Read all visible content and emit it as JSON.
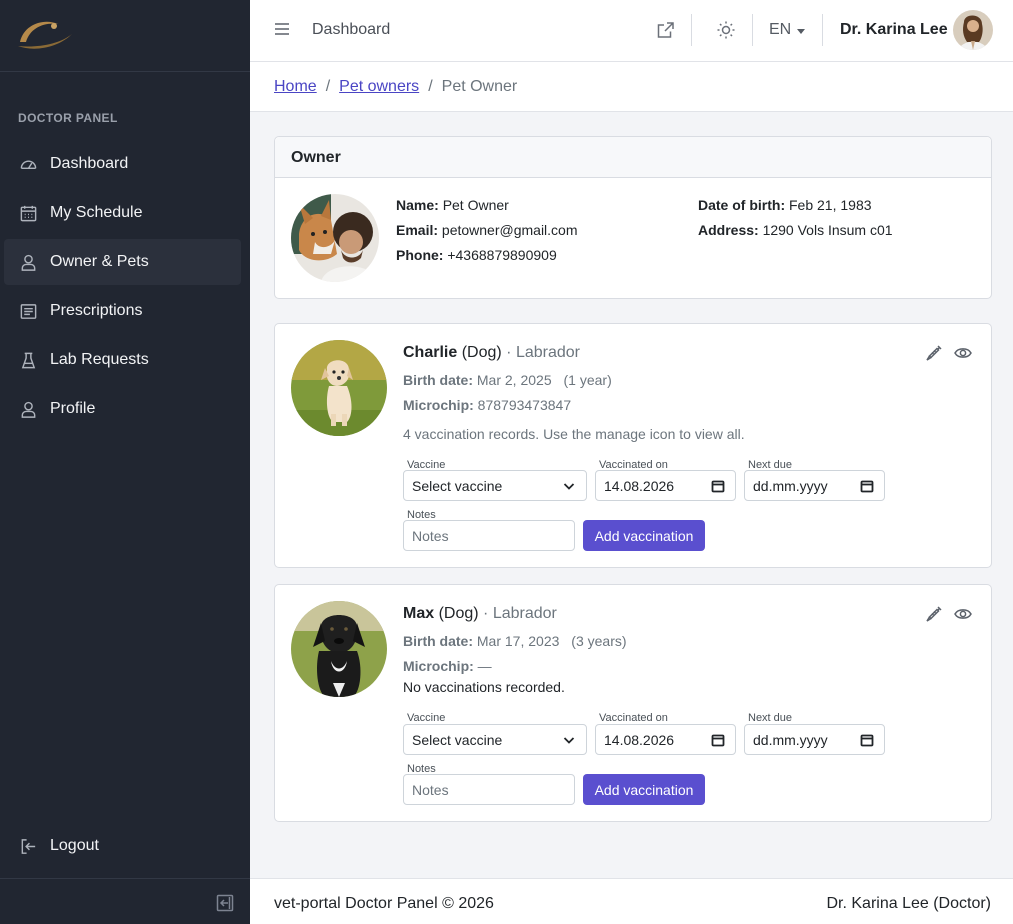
{
  "sidebar": {
    "section_title": "DOCTOR PANEL",
    "items": [
      {
        "label": "Dashboard",
        "icon": "speedometer-icon"
      },
      {
        "label": "My Schedule",
        "icon": "calendar-icon"
      },
      {
        "label": "Owner & Pets",
        "icon": "user-icon",
        "active": true
      },
      {
        "label": "Prescriptions",
        "icon": "document-icon"
      },
      {
        "label": "Lab Requests",
        "icon": "flask-icon"
      },
      {
        "label": "Profile",
        "icon": "user-icon"
      }
    ],
    "logout_label": "Logout"
  },
  "header": {
    "title": "Dashboard",
    "language": "EN",
    "user_name": "Dr. Karina Lee"
  },
  "breadcrumb": {
    "home": "Home",
    "pet_owners": "Pet owners",
    "current": "Pet Owner",
    "separator": "/"
  },
  "owner": {
    "card_title": "Owner",
    "name_label": "Name:",
    "name": "Pet Owner",
    "email_label": "Email:",
    "email": "petowner@gmail.com",
    "phone_label": "Phone:",
    "phone": "+4368879890909",
    "dob_label": "Date of birth:",
    "dob": "Feb 21, 1983",
    "address_label": "Address:",
    "address": "1290 Vols Insum c01"
  },
  "pets": [
    {
      "name": "Charlie",
      "species": "(Dog)",
      "breed": "· Labrador",
      "birth_label": "Birth date:",
      "birth_date": "Mar 2, 2025",
      "age": "(1 year)",
      "microchip_label": "Microchip:",
      "microchip": "878793473847",
      "vaccination_note": "4 vaccination records. Use the manage icon to view all.",
      "form": {
        "vaccine_label": "Vaccine",
        "vaccine_value": "Select vaccine",
        "vaccinated_label": "Vaccinated on",
        "vaccinated_value": "14.08.2026",
        "next_due_label": "Next due",
        "next_due_value": "dd.mm.yyyy",
        "notes_label": "Notes",
        "notes_placeholder": "Notes",
        "add_button": "Add vaccination"
      }
    },
    {
      "name": "Max",
      "species": "(Dog)",
      "breed": "· Labrador",
      "birth_label": "Birth date:",
      "birth_date": "Mar 17, 2023",
      "age": "(3 years)",
      "microchip_label": "Microchip:",
      "microchip": "—",
      "vaccination_note": "No vaccinations recorded.",
      "form": {
        "vaccine_label": "Vaccine",
        "vaccine_value": "Select vaccine",
        "vaccinated_label": "Vaccinated on",
        "vaccinated_value": "14.08.2026",
        "next_due_label": "Next due",
        "next_due_value": "dd.mm.yyyy",
        "notes_label": "Notes",
        "notes_placeholder": "Notes",
        "add_button": "Add vaccination"
      }
    }
  ],
  "footer": {
    "left": "vet-portal Doctor Panel © 2026",
    "right": "Dr. Karina Lee (Doctor)"
  },
  "colors": {
    "sidebar_bg": "#212631",
    "accent": "#5a4fcf",
    "link": "#4a45c4"
  }
}
